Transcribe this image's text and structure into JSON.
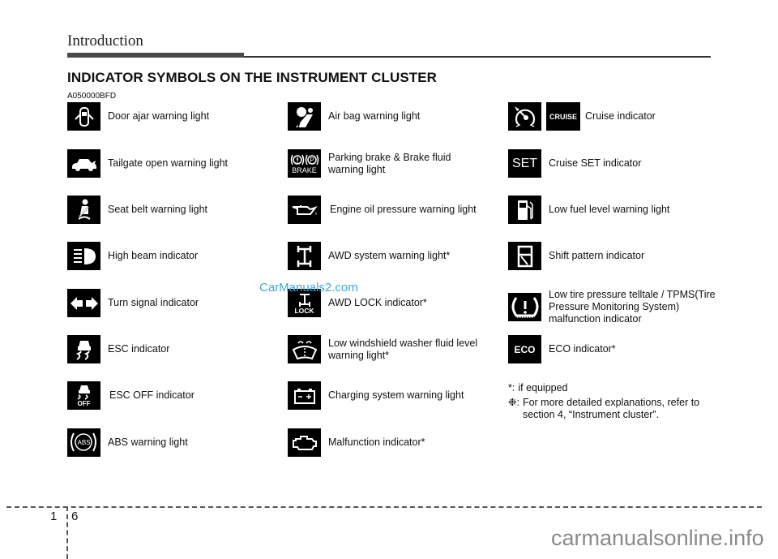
{
  "header": {
    "section_title": "Introduction",
    "page_heading": "INDICATOR SYMBOLS ON THE INSTRUMENT CLUSTER",
    "doc_code": "A050000BFD"
  },
  "columns": [
    {
      "items": [
        {
          "icon": "door-ajar-icon",
          "label": "Door ajar warning light"
        },
        {
          "icon": "tailgate-open-icon",
          "label": "Tailgate open warning light"
        },
        {
          "icon": "seat-belt-icon",
          "label": "Seat belt warning light"
        },
        {
          "icon": "high-beam-icon",
          "label": "High beam indicator"
        },
        {
          "icon": "turn-signal-icon",
          "label": "Turn signal indicator"
        },
        {
          "icon": "esc-icon",
          "label": "ESC indicator"
        },
        {
          "icon": "esc-off-icon",
          "icon_text": "OFF",
          "label": "ESC OFF indicator"
        },
        {
          "icon": "abs-icon",
          "icon_text": "ABS",
          "label": "ABS warning light"
        }
      ]
    },
    {
      "items": [
        {
          "icon": "air-bag-icon",
          "label": "Air bag warning light"
        },
        {
          "icon": "brake-icon",
          "icon_text": "BRAKE",
          "label": "Parking brake & Brake fluid warning light"
        },
        {
          "icon": "oil-pressure-icon",
          "label": "Engine oil pressure warning light"
        },
        {
          "icon": "awd-system-icon",
          "label": "AWD system warning light*"
        },
        {
          "icon": "awd-lock-icon",
          "icon_text": "LOCK",
          "label": "AWD LOCK indicator*"
        },
        {
          "icon": "washer-fluid-icon",
          "label": "Low windshield washer fluid level warning light*"
        },
        {
          "icon": "battery-icon",
          "label": "Charging system warning light"
        },
        {
          "icon": "engine-check-icon",
          "label": "Malfunction indicator*"
        }
      ]
    },
    {
      "items": [
        {
          "icon": "cruise-icon",
          "icon_text": "CRUISE",
          "label": "Cruise indicator"
        },
        {
          "icon": "cruise-set-icon",
          "icon_text": "SET",
          "label": "Cruise SET indicator"
        },
        {
          "icon": "low-fuel-icon",
          "label": "Low fuel level warning light"
        },
        {
          "icon": "shift-pattern-icon",
          "label": "Shift pattern indicator"
        },
        {
          "icon": "tire-pressure-icon",
          "label": "Low tire pressure telltale / TPMS(Tire Pressure Monitoring System) malfunction indicator"
        },
        {
          "icon": "eco-icon",
          "icon_text": "ECO",
          "label": "ECO indicator*"
        }
      ]
    }
  ],
  "footnotes": {
    "note1_mark": "*:",
    "note1_text": "if equipped",
    "note2_mark": "❉:",
    "note2_text": "For more detailed explanations, refer to section 4, “Instrument cluster”."
  },
  "footer": {
    "chapter": "1",
    "page": "6"
  },
  "watermarks": {
    "overlay": "CarManuals2.com",
    "site": "carmanualsonline.info"
  }
}
